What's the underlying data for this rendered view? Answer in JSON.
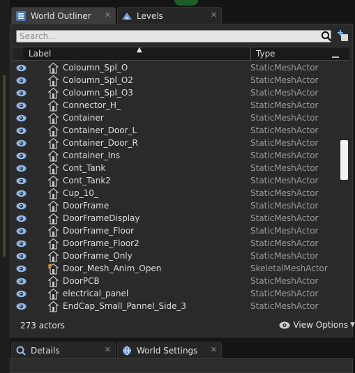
{
  "top_tabs": [
    {
      "label": "World Outliner",
      "icon": "list-icon",
      "close": "✕"
    },
    {
      "label": "Levels",
      "icon": "levels-icon",
      "close": "✕"
    }
  ],
  "search": {
    "placeholder": "Search..."
  },
  "columns": {
    "label": "Label",
    "type": "Type",
    "sort_arrow": "▲"
  },
  "rows": [
    {
      "label": "Coloumn_Spl_O",
      "type": "StaticMeshActor",
      "icon": "static-mesh-actor-icon"
    },
    {
      "label": "Coloumn_Spl_O2",
      "type": "StaticMeshActor",
      "icon": "static-mesh-actor-icon"
    },
    {
      "label": "Coloumn_Spl_O3",
      "type": "StaticMeshActor",
      "icon": "static-mesh-actor-icon"
    },
    {
      "label": "Connector_H_",
      "type": "StaticMeshActor",
      "icon": "static-mesh-actor-icon"
    },
    {
      "label": "Container",
      "type": "StaticMeshActor",
      "icon": "static-mesh-actor-icon"
    },
    {
      "label": "Container_Door_L",
      "type": "StaticMeshActor",
      "icon": "static-mesh-actor-icon"
    },
    {
      "label": "Container_Door_R",
      "type": "StaticMeshActor",
      "icon": "static-mesh-actor-icon"
    },
    {
      "label": "Container_Ins",
      "type": "StaticMeshActor",
      "icon": "static-mesh-actor-icon"
    },
    {
      "label": "Cont_Tank",
      "type": "StaticMeshActor",
      "icon": "static-mesh-actor-icon"
    },
    {
      "label": "Cont_Tank2",
      "type": "StaticMeshActor",
      "icon": "static-mesh-actor-icon"
    },
    {
      "label": "Cup_10_",
      "type": "StaticMeshActor",
      "icon": "static-mesh-actor-icon"
    },
    {
      "label": "DoorFrame",
      "type": "StaticMeshActor",
      "icon": "static-mesh-actor-icon"
    },
    {
      "label": "DoorFrameDisplay",
      "type": "StaticMeshActor",
      "icon": "static-mesh-actor-icon"
    },
    {
      "label": "DoorFrame_Floor",
      "type": "StaticMeshActor",
      "icon": "static-mesh-actor-icon"
    },
    {
      "label": "DoorFrame_Floor2",
      "type": "StaticMeshActor",
      "icon": "static-mesh-actor-icon"
    },
    {
      "label": "DoorFrame_Only",
      "type": "StaticMeshActor",
      "icon": "static-mesh-actor-icon"
    },
    {
      "label": "Door_Mesh_Anim_Open",
      "type": "SkeletalMeshActor",
      "icon": "skeletal-mesh-actor-icon"
    },
    {
      "label": "DoorPCB",
      "type": "StaticMeshActor",
      "icon": "static-mesh-actor-icon"
    },
    {
      "label": "electrical_panel",
      "type": "StaticMeshActor",
      "icon": "static-mesh-actor-icon"
    },
    {
      "label": "EndCap_Small_Pannel_Side_3",
      "type": "StaticMeshActor",
      "icon": "static-mesh-actor-icon"
    }
  ],
  "footer": {
    "actor_count": "273 actors",
    "view_options": "View Options",
    "caret": "▼"
  },
  "bottom_tabs": [
    {
      "label": "Details",
      "icon": "details-icon",
      "close": "✕"
    },
    {
      "label": "World Settings",
      "icon": "world-settings-icon",
      "close": "✕"
    }
  ],
  "colors": {
    "panel_bg": "#2a2a2a",
    "active_tab": "#3c3c3c",
    "eye_blue": "#8fb7e8",
    "skeletal_orange": "#e08a2b",
    "scroll_thumb": "#f2f2f2"
  }
}
